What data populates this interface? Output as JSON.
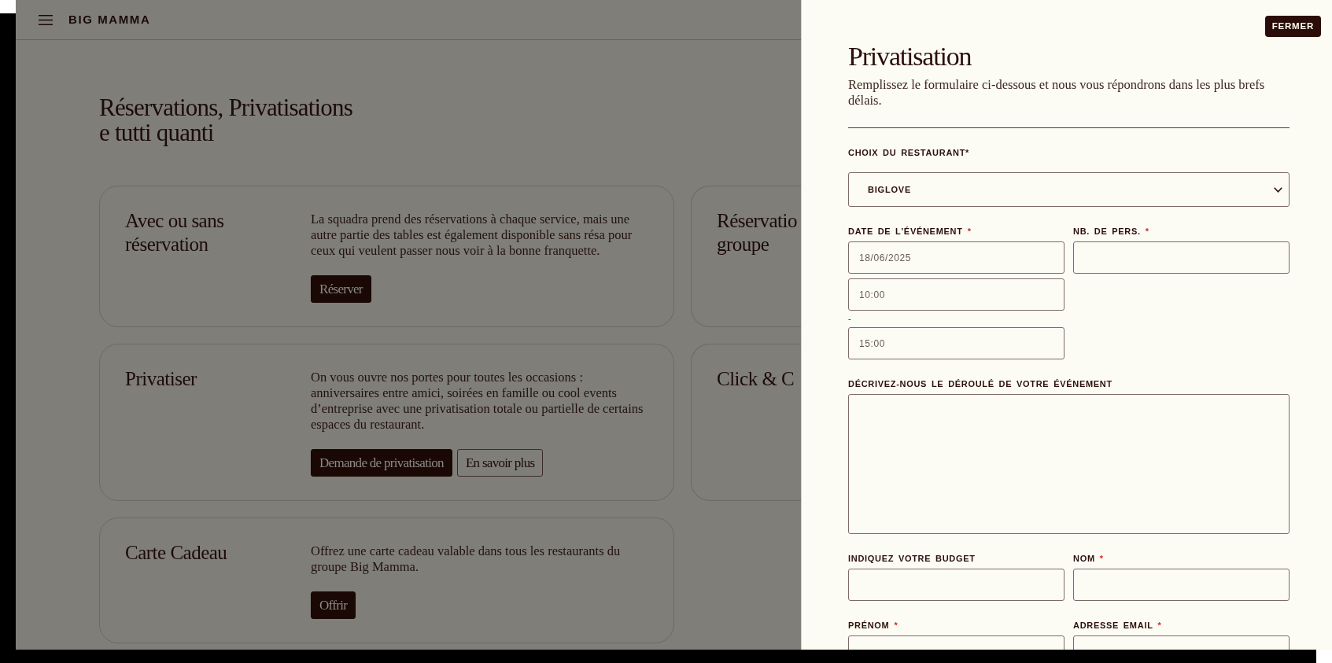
{
  "header": {
    "logo": "BIG MAMMA"
  },
  "page_title_lines": [
    "Réservations, Privatisations",
    "e tutti quanti"
  ],
  "cards": [
    {
      "title_lines": [
        "Avec ou sans",
        "réservation"
      ],
      "description": "La squadra prend des réservations à chaque service, mais une autre partie des tables est également disponible sans résa pour ceux qui veulent passer nous voir à la bonne franquette.",
      "buttons": [
        {
          "label": "Réserver",
          "kind": "primary"
        }
      ]
    },
    {
      "title_lines": [
        "Réservatio",
        "groupe"
      ]
    },
    {
      "title_lines": [
        "Privatiser"
      ],
      "description": "On vous ouvre nos portes pour toutes les occasions : anniversaires entre amici, soirées en famille ou cool events d’entreprise avec une privatisation totale ou partielle de certains espaces du restaurant.",
      "buttons": [
        {
          "label": "Demande de privatisation",
          "kind": "primary"
        },
        {
          "label": "En savoir plus",
          "kind": "outline"
        }
      ]
    },
    {
      "title_lines": [
        "Click & C"
      ]
    },
    {
      "title_lines": [
        "Carte Cadeau"
      ],
      "description": "Offrez une carte cadeau valable dans tous les restaurants du groupe Big Mamma.",
      "buttons": [
        {
          "label": "Offrir",
          "kind": "primary"
        }
      ]
    }
  ],
  "drawer": {
    "close_button": "FERMER",
    "title": "Privatisation",
    "subtitle": "Remplissez le formulaire ci-dessous et nous vous répondrons dans les plus brefs délais.",
    "form_rows": [
      [
        {
          "kind": "select",
          "label": "CHOIX DU RESTAURANT*",
          "value": "BIGLOVE"
        }
      ],
      [
        {
          "kind": "datetime",
          "label": "DATE DE L'ÉVÉNEMENT",
          "required_mark": "*",
          "date": "18/06/2025",
          "start_time": "10:00",
          "separator": "-",
          "end_time": "15:00"
        },
        {
          "kind": "text",
          "label": "NB. DE PERS.",
          "required_mark": "*"
        }
      ],
      [
        {
          "kind": "textarea",
          "label": "DÉCRIVEZ-NOUS LE DÉROULÉ DE VOTRE ÉVÉNEMENT"
        }
      ],
      [
        {
          "kind": "text",
          "label": "INDIQUEZ VOTRE BUDGET"
        },
        {
          "kind": "text",
          "label": "NOM",
          "required_mark": "*"
        }
      ],
      [
        {
          "kind": "text",
          "label": "PRÉNOM",
          "required_mark": "*"
        },
        {
          "kind": "text",
          "label": "ADRESSE EMAIL",
          "required_mark": "*"
        }
      ]
    ]
  }
}
